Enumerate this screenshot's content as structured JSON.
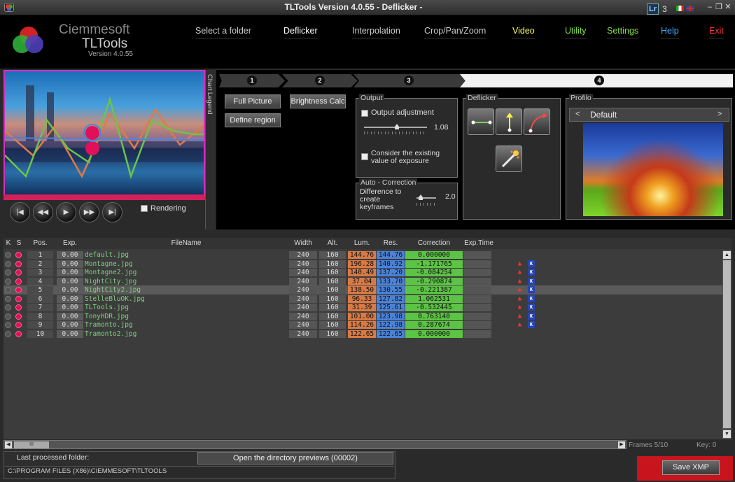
{
  "window": {
    "title": "TLTools Version 4.0.55 - Deflicker -",
    "lr_badge": "Lr",
    "lr_version": "3",
    "controls": [
      "–",
      "❐",
      "✕"
    ]
  },
  "brand": {
    "company": "Ciemmesoft",
    "product": "TLTools",
    "version": "Version 4.0.55"
  },
  "nav": [
    {
      "label": "Select a folder",
      "color": "#cccccc"
    },
    {
      "label": "Deflicker",
      "color": "#ffffff"
    },
    {
      "label": "Interpolation",
      "color": "#cccccc"
    },
    {
      "label": "Crop/Pan/Zoom",
      "color": "#cccccc"
    },
    {
      "label": "Video",
      "color": "#ffff66"
    },
    {
      "label": "Utility",
      "color": "#88dd44"
    },
    {
      "label": "Settings",
      "color": "#88dd44"
    },
    {
      "label": "Help",
      "color": "#4aa8ff"
    },
    {
      "label": "Exit",
      "color": "#ff3333"
    }
  ],
  "preview": {
    "rendering_label": "Rendering",
    "chart_legend": "Chart Legend"
  },
  "steps": [
    "1",
    "2",
    "3",
    "4"
  ],
  "step1": {
    "full_picture": "Full Picture",
    "define_region": "Define region"
  },
  "step2": {
    "brightness_calc": "Brightness Calc"
  },
  "output": {
    "title": "Output",
    "adjustment_label": "Output adjustment",
    "slider_value": "1.08",
    "exposure_label_1": "Consider the existing",
    "exposure_label_2": "value of exposure"
  },
  "auto_correction": {
    "title": "Auto - Correction",
    "label_1": "Difference to",
    "label_2": "create",
    "label_3": "keyframes",
    "value": "2.0"
  },
  "deflicker": {
    "title": "Deflicker"
  },
  "profile": {
    "title": "Profilo",
    "prev": "<",
    "name": "Default",
    "next": ">"
  },
  "table": {
    "headers": [
      "K",
      "S",
      "Pos.",
      "Exp.",
      "FileName",
      "Width",
      "Alt.",
      "Lum.",
      "Res.",
      "Correction",
      "Exp.Time"
    ],
    "rows": [
      {
        "pos": "1",
        "exp": "0.00",
        "name": "default.jpg",
        "w": "240",
        "a": "160",
        "lum": "144.76",
        "res": "144.76",
        "corr": "0.000000"
      },
      {
        "pos": "2",
        "exp": "0.00",
        "name": "Montagne.jpg",
        "w": "240",
        "a": "160",
        "lum": "196.28",
        "res": "140.92",
        "corr": "-1.171765"
      },
      {
        "pos": "3",
        "exp": "0.00",
        "name": "Montagne2.jpg",
        "w": "240",
        "a": "160",
        "lum": "140.49",
        "res": "137.20",
        "corr": "-0.084254"
      },
      {
        "pos": "4",
        "exp": "0.00",
        "name": "NightCity.jpg",
        "w": "240",
        "a": "160",
        "lum": "37.04",
        "res": "133.70",
        "corr": "-0.290874"
      },
      {
        "pos": "5",
        "exp": "0.00",
        "name": "NightCity2.jpg",
        "w": "240",
        "a": "160",
        "lum": "138.50",
        "res": "130.55",
        "corr": "-0.221387"
      },
      {
        "pos": "6",
        "exp": "0.00",
        "name": "StelleBluOK.jpg",
        "w": "240",
        "a": "160",
        "lum": "96.33",
        "res": "127.82",
        "corr": "1.062531"
      },
      {
        "pos": "7",
        "exp": "0.00",
        "name": "TLTools.jpg",
        "w": "240",
        "a": "160",
        "lum": "31.39",
        "res": "125.61",
        "corr": "-0.532445"
      },
      {
        "pos": "8",
        "exp": "0.00",
        "name": "TonyHDR.jpg",
        "w": "240",
        "a": "160",
        "lum": "101.00",
        "res": "123.98",
        "corr": "0.763140"
      },
      {
        "pos": "9",
        "exp": "0.00",
        "name": "Tramonto.jpg",
        "w": "240",
        "a": "160",
        "lum": "114.26",
        "res": "122.98",
        "corr": "0.287674"
      },
      {
        "pos": "10",
        "exp": "0.00",
        "name": "Tramonto2.jpg",
        "w": "240",
        "a": "160",
        "lum": "122.65",
        "res": "122.65",
        "corr": "0.000000"
      }
    ],
    "warn_rows": [
      2,
      3,
      4,
      5,
      6,
      7,
      8,
      9
    ],
    "selected_row": 5
  },
  "status": {
    "frames": "Frames 5/10",
    "key": "Key: 0",
    "scroll_grip": "III"
  },
  "footer": {
    "last_folder_label": "Last processed folder:",
    "open_previews": "Open the directory previews (00002)",
    "folder_path": "C:\\PROGRAM FILES (X86)\\CIEMMESOFT\\TLTOOLS",
    "save_xmp": "Save XMP"
  }
}
